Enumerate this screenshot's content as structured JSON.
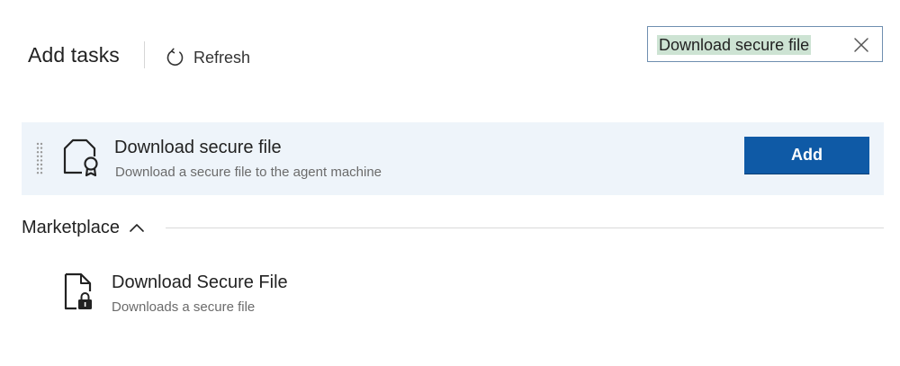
{
  "header": {
    "title": "Add tasks",
    "refresh_label": "Refresh"
  },
  "search": {
    "value": "Download secure file"
  },
  "task": {
    "title": "Download secure file",
    "description": "Download a secure file to the agent machine",
    "add_label": "Add",
    "icon": "file-certificate-icon"
  },
  "marketplace": {
    "section_label": "Marketplace",
    "expanded": true,
    "items": [
      {
        "title": "Download Secure File",
        "description": "Downloads a secure file",
        "icon": "file-lock-icon"
      }
    ]
  },
  "colors": {
    "accent": "#0f5aa6",
    "card_background": "#eef4fa",
    "search_highlight": "#cde3d3",
    "search_border": "#6f8fb0"
  }
}
